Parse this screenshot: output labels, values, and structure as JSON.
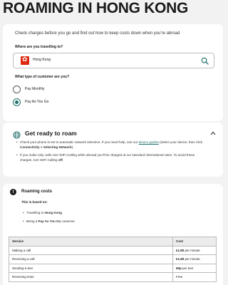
{
  "page": {
    "title": "ROAMING IN HONG KONG"
  },
  "checker": {
    "intro": "Check charges before you go and find out how to keep costs down when you're abroad",
    "destination_label": "Where are you travelling to?",
    "destination_value": "Hong Kong",
    "customer_label": "What type of customer are you?",
    "options": [
      {
        "label": "Pay Monthly",
        "selected": false
      },
      {
        "label": "Pay As You Go",
        "selected": true
      }
    ]
  },
  "ready": {
    "title": "Get ready to roam",
    "bullet1_pre": "Check your phone is set to automatic network selection. If you need help, see our ",
    "bullet1_link": "device guides",
    "bullet1_mid": " (select your device, then click ",
    "bullet1_bold": "Connectivity > Selecting Network",
    "bullet1_post": ").",
    "bullet2_pre": "If you make only calls over WiFi Calling while abroad you'll be charged at our standard international rates. To avoid these charges, turn WiFi Calling ",
    "bullet2_bold": "off",
    "bullet2_post": "."
  },
  "costs": {
    "icon_glyph": "!",
    "title": "Roaming costs",
    "based_on": "This is based on:",
    "item1_pre": "Travelling to ",
    "item1_bold": "Hong Kong",
    "item2_pre": "Being a ",
    "item2_bold": "Pay As You Go",
    "item2_post": " customer",
    "table": {
      "headers": [
        "Service",
        "Cost"
      ],
      "rows": [
        {
          "service": "Making a call",
          "cost_bold": "£1.80",
          "cost_rest": " per minute"
        },
        {
          "service": "Receiving a call",
          "cost_bold": "£1.80",
          "cost_rest": " per minute"
        },
        {
          "service": "Sending a text",
          "cost_bold": "60p",
          "cost_rest": " per text"
        },
        {
          "service": "Receiving texts",
          "cost_bold": "",
          "cost_rest": "Free"
        }
      ]
    }
  },
  "colors": {
    "accent": "#1f6f6a",
    "flag": "#de2910",
    "page_bg": "#f2f2f2"
  },
  "icons": {
    "flag": "hong-kong-flag-icon",
    "search": "search-icon",
    "globe": "globe-icon",
    "collapse": "chevron-up-icon",
    "alert": "alert-icon"
  }
}
